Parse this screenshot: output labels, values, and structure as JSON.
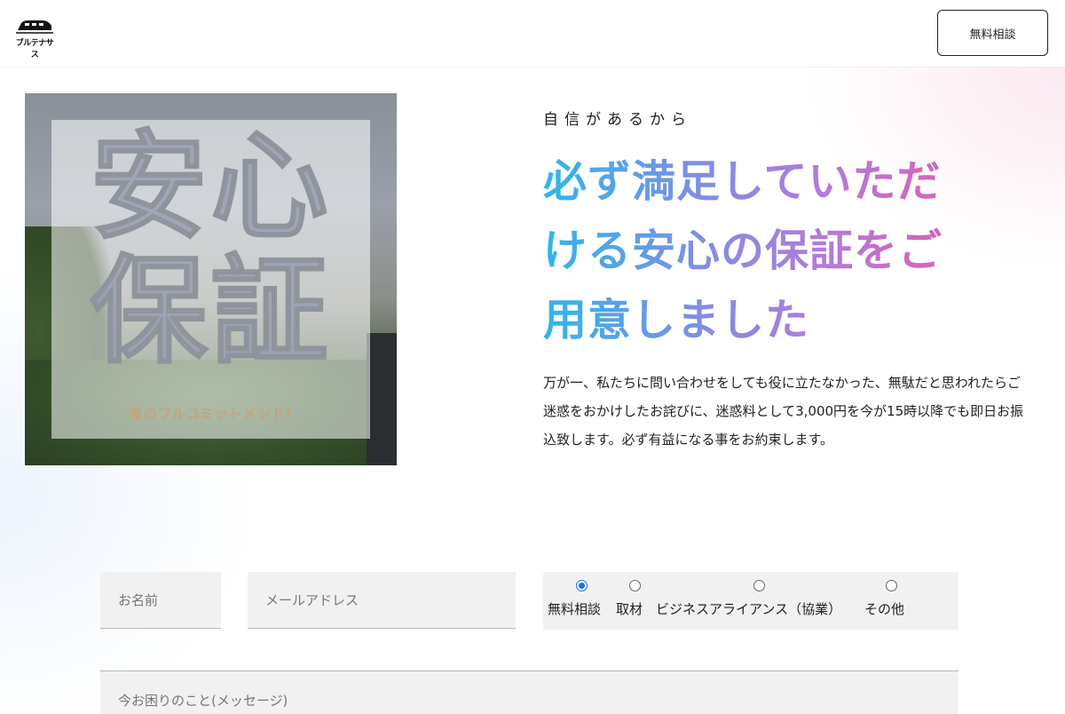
{
  "header": {
    "logo_text": "ブルテナサス",
    "consult_button": "無料相談"
  },
  "hero": {
    "card_line1": "安心",
    "card_line2": "保証",
    "card_sub": "鬼のフルコミットメント!"
  },
  "intro": {
    "eyebrow": "自信があるから",
    "headline_lines": [
      "必ず満足していただ",
      "ける安心の保証をご",
      "用意しました"
    ],
    "description": "万が一、私たちに問い合わせをしても役に立たなかった、無駄だと思われたらご迷惑をおかけしたお詫びに、迷惑料として3,000円を今が15時以降でも即日お振込致します。必ず有益になる事をお約束します。"
  },
  "form": {
    "name_placeholder": "お名前",
    "email_placeholder": "メールアドレス",
    "message_placeholder": "今お困りのこと(メッセージ)",
    "radio_options": [
      {
        "label": "無料相談",
        "checked": true
      },
      {
        "label": "取材",
        "checked": false
      },
      {
        "label": "ビジネスアライアンス（協業）",
        "checked": false
      },
      {
        "label": "その他",
        "checked": false
      }
    ]
  },
  "colors": {
    "gradient_start": "#2fb7e8",
    "gradient_mid": "#b57ad9",
    "gradient_end": "#e45aa2",
    "card_sub": "#c9a27a",
    "radio_selected": "#1a73e8"
  }
}
